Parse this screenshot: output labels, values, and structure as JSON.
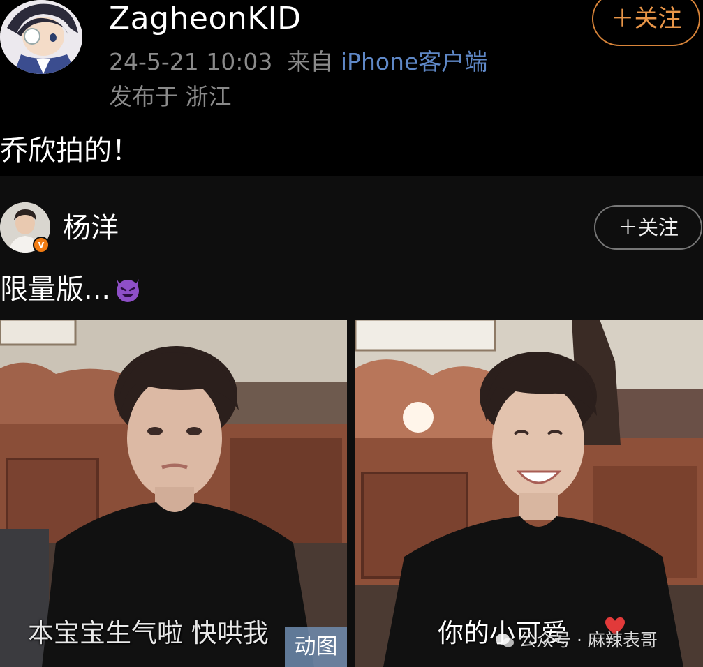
{
  "post": {
    "username": "ZagheonKID",
    "time": "24-5-21 10:03",
    "source_prefix": "来自",
    "source_app": "iPhone客户端",
    "location": "发布于 浙江",
    "follow_label": "＋关注",
    "text": "乔欣拍的！"
  },
  "repost": {
    "username": "杨洋",
    "follow_label": "＋关注",
    "text": "限量版...",
    "text_emoji": "smiling-devil-emoji",
    "images": [
      {
        "caption": "本宝宝生气啦 快哄我",
        "badge": "动图"
      },
      {
        "caption": "你的小可爱",
        "caption_emoji": "heart-icon",
        "watermark": "公众号 · 麻辣表哥"
      }
    ]
  },
  "colors": {
    "accent_follow": "#d9853a",
    "link_blue": "#5f88c7",
    "meta_gray": "#8a8a8a",
    "verified_badge": "#f07b12"
  }
}
